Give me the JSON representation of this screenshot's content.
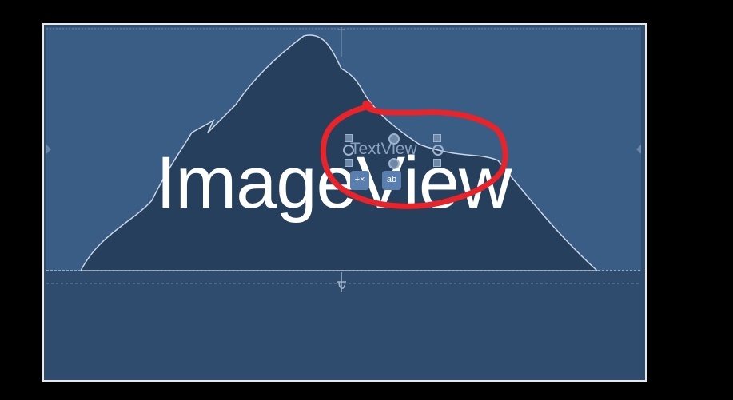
{
  "canvas": {
    "image_view_label": "ImageView",
    "text_view_label": "TextView",
    "delete_badge_symbol": "+×",
    "text_badge_symbol": "ab",
    "colors": {
      "image_bg": "#3a5d85",
      "lower_bg": "#2f4b6e",
      "mountain": "#263f5c",
      "annotation": "#e8232a"
    },
    "icons": {
      "mountain": "mountain-placeholder-icon",
      "delete_badge": "constraint-clear-icon",
      "text_badge": "text-baseline-icon"
    }
  }
}
